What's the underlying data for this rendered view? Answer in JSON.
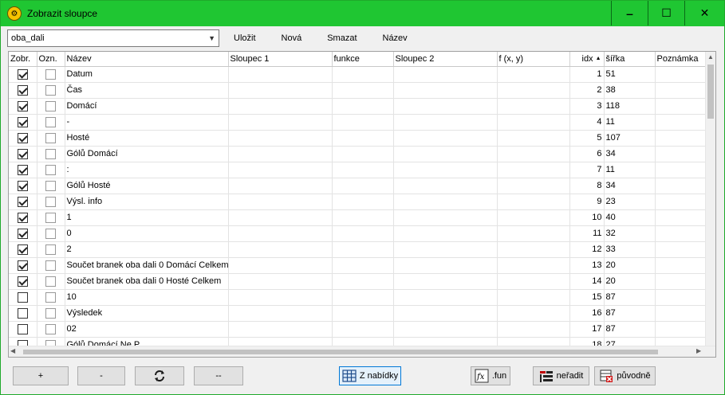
{
  "window": {
    "title": "Zobrazit sloupce",
    "icon": "app-icon",
    "minimize_label": "‒",
    "maximize_label": "☐",
    "close_label": "✕"
  },
  "toolbar": {
    "profile_value": "oba_dali",
    "save_label": "Uložit",
    "new_label": "Nová",
    "delete_label": "Smazat",
    "rename_label": "Název"
  },
  "grid": {
    "columns": [
      "Zobr.",
      "Ozn.",
      "Název",
      "Sloupec 1",
      "funkce",
      "Sloupec 2",
      "f (x, y)",
      "idx",
      "šířka",
      "Poznámka"
    ],
    "sort_indicator": "▲",
    "rows": [
      {
        "zobr": true,
        "ozn": false,
        "nazev": "Datum",
        "idx": "1",
        "sirka": "51"
      },
      {
        "zobr": true,
        "ozn": false,
        "nazev": "Čas",
        "idx": "2",
        "sirka": "38"
      },
      {
        "zobr": true,
        "ozn": false,
        "nazev": "Domácí",
        "idx": "3",
        "sirka": "118"
      },
      {
        "zobr": true,
        "ozn": false,
        "nazev": "-",
        "idx": "4",
        "sirka": "11"
      },
      {
        "zobr": true,
        "ozn": false,
        "nazev": "Hosté",
        "idx": "5",
        "sirka": "107"
      },
      {
        "zobr": true,
        "ozn": false,
        "nazev": "Gólů Domácí",
        "idx": "6",
        "sirka": "34"
      },
      {
        "zobr": true,
        "ozn": false,
        "nazev": ":",
        "idx": "7",
        "sirka": "11"
      },
      {
        "zobr": true,
        "ozn": false,
        "nazev": "Gólů Hosté",
        "idx": "8",
        "sirka": "34"
      },
      {
        "zobr": true,
        "ozn": false,
        "nazev": "Výsl. info",
        "idx": "9",
        "sirka": "23"
      },
      {
        "zobr": true,
        "ozn": false,
        "nazev": "1",
        "idx": "10",
        "sirka": "40"
      },
      {
        "zobr": true,
        "ozn": false,
        "nazev": "0",
        "idx": "11",
        "sirka": "32"
      },
      {
        "zobr": true,
        "ozn": false,
        "nazev": "2",
        "idx": "12",
        "sirka": "33"
      },
      {
        "zobr": true,
        "ozn": false,
        "nazev": "Součet branek oba dali 0 Domácí Celkem",
        "idx": "13",
        "sirka": "20"
      },
      {
        "zobr": true,
        "ozn": false,
        "nazev": "Součet branek oba dali 0 Hosté Celkem",
        "idx": "14",
        "sirka": "20"
      },
      {
        "zobr": false,
        "ozn": false,
        "nazev": "10",
        "idx": "15",
        "sirka": "87"
      },
      {
        "zobr": false,
        "ozn": false,
        "nazev": "Výsledek",
        "idx": "16",
        "sirka": "87"
      },
      {
        "zobr": false,
        "ozn": false,
        "nazev": "02",
        "idx": "17",
        "sirka": "87"
      },
      {
        "zobr": false,
        "ozn": false,
        "nazev": "Gólů Domácí Ne P",
        "idx": "18",
        "sirka": "27"
      }
    ]
  },
  "bottom": {
    "add_label": "+",
    "remove_label": "-",
    "refresh_icon": "refresh-icon",
    "separator_label": "--",
    "from_menu_label": "Z nabídky",
    "fun_label": ".fun",
    "unsort_label": "neřadit",
    "original_label": "původně"
  }
}
